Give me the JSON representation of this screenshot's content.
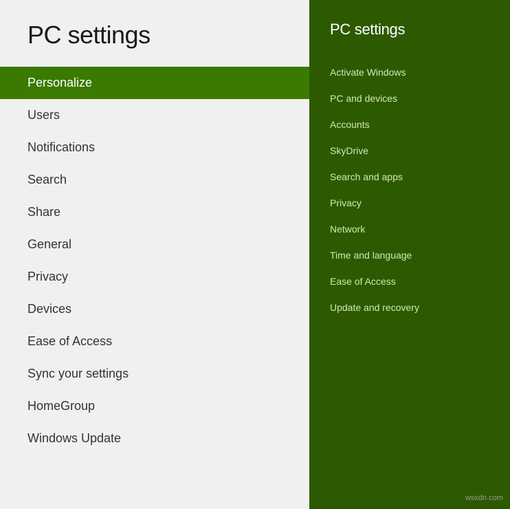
{
  "left": {
    "title": "PC settings",
    "nav_items": [
      {
        "label": "Personalize",
        "active": true
      },
      {
        "label": "Users",
        "active": false
      },
      {
        "label": "Notifications",
        "active": false
      },
      {
        "label": "Search",
        "active": false
      },
      {
        "label": "Share",
        "active": false
      },
      {
        "label": "General",
        "active": false
      },
      {
        "label": "Privacy",
        "active": false
      },
      {
        "label": "Devices",
        "active": false
      },
      {
        "label": "Ease of Access",
        "active": false
      },
      {
        "label": "Sync your settings",
        "active": false
      },
      {
        "label": "HomeGroup",
        "active": false
      },
      {
        "label": "Windows Update",
        "active": false
      }
    ]
  },
  "right": {
    "title": "PC settings",
    "nav_items": [
      {
        "label": "Activate Windows"
      },
      {
        "label": "PC and devices"
      },
      {
        "label": "Accounts"
      },
      {
        "label": "SkyDrive"
      },
      {
        "label": "Search and apps"
      },
      {
        "label": "Privacy"
      },
      {
        "label": "Network"
      },
      {
        "label": "Time and language"
      },
      {
        "label": "Ease of Access"
      },
      {
        "label": "Update and recovery"
      }
    ]
  },
  "watermark": "wsxdn.com"
}
